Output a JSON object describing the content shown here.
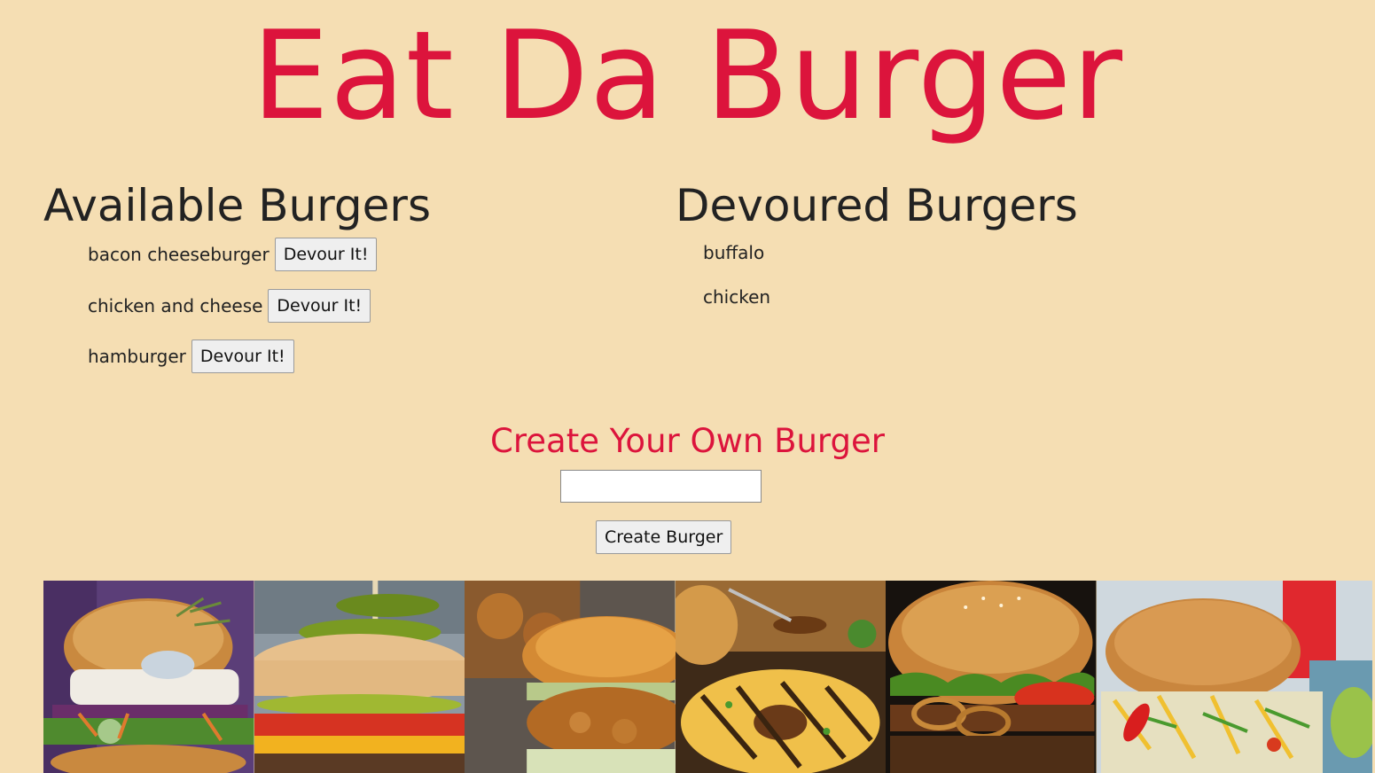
{
  "header": {
    "title": "Eat Da Burger"
  },
  "available": {
    "heading": "Available Burgers",
    "items": [
      {
        "name": "bacon cheeseburger",
        "button_label": "Devour It!"
      },
      {
        "name": "chicken and cheese",
        "button_label": "Devour It!"
      },
      {
        "name": "hamburger",
        "button_label": "Devour It!"
      }
    ]
  },
  "devoured": {
    "heading": "Devoured Burgers",
    "items": [
      {
        "name": "buffalo"
      },
      {
        "name": "chicken"
      }
    ]
  },
  "create": {
    "heading": "Create Your Own Burger",
    "input_value": "",
    "button_label": "Create Burger"
  },
  "colors": {
    "background": "#f5deb3",
    "title": "#dc143c",
    "text": "#222222"
  },
  "gallery": {
    "photos": [
      {
        "icon": "fish-burger-photo",
        "bg": "#6b4a86"
      },
      {
        "icon": "pickle-burger-photo",
        "bg": "#8a96a0"
      },
      {
        "icon": "fried-chicken-burger-photo",
        "bg": "#6a4a2e"
      },
      {
        "icon": "pineapple-burger-photo",
        "bg": "#2d4a1e"
      },
      {
        "icon": "onion-ring-burger-photo",
        "bg": "#1a1410"
      },
      {
        "icon": "spicy-slaw-burger-photo",
        "bg": "#c8d4dc"
      }
    ]
  }
}
